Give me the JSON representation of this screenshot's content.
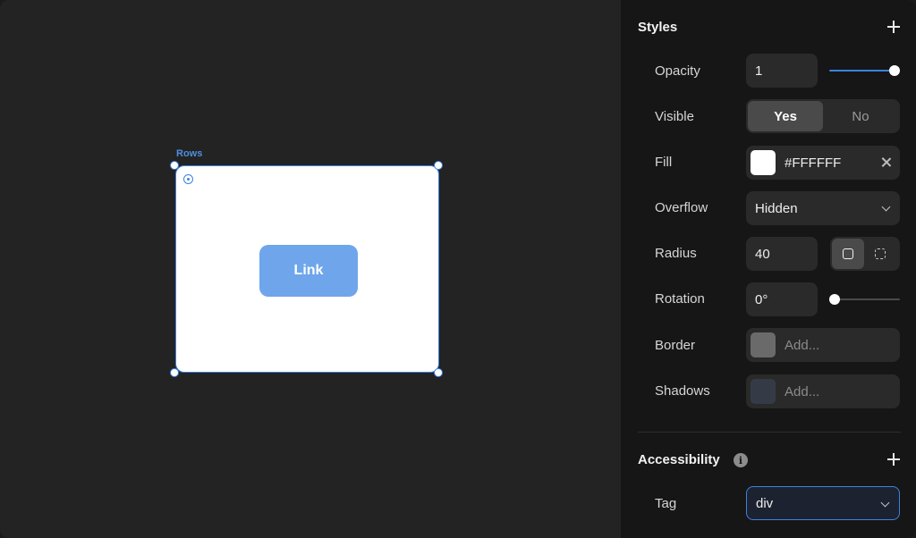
{
  "canvas": {
    "frame_label": "Rows",
    "button_label": "Link"
  },
  "panel": {
    "styles": {
      "title": "Styles",
      "opacity": {
        "label": "Opacity",
        "value": "1",
        "slider_fraction": 1.0
      },
      "visible": {
        "label": "Visible",
        "options": [
          "Yes",
          "No"
        ],
        "selected": "Yes"
      },
      "fill": {
        "label": "Fill",
        "value": "#FFFFFF",
        "swatch": "#ffffff"
      },
      "overflow": {
        "label": "Overflow",
        "value": "Hidden"
      },
      "radius": {
        "label": "Radius",
        "value": "40",
        "mode": "all-corners"
      },
      "rotation": {
        "label": "Rotation",
        "value": "0°",
        "slider_fraction": 0.0
      },
      "border": {
        "label": "Border",
        "placeholder": "Add...",
        "swatch": "#6a6a6a"
      },
      "shadows": {
        "label": "Shadows",
        "placeholder": "Add...",
        "swatch": "#353b46"
      }
    },
    "accessibility": {
      "title": "Accessibility",
      "tag": {
        "label": "Tag",
        "value": "div"
      }
    }
  },
  "colors": {
    "accent": "#3b82e0",
    "button": "#6fa6eb",
    "panel_bg": "#161616",
    "canvas_bg": "#232323"
  }
}
